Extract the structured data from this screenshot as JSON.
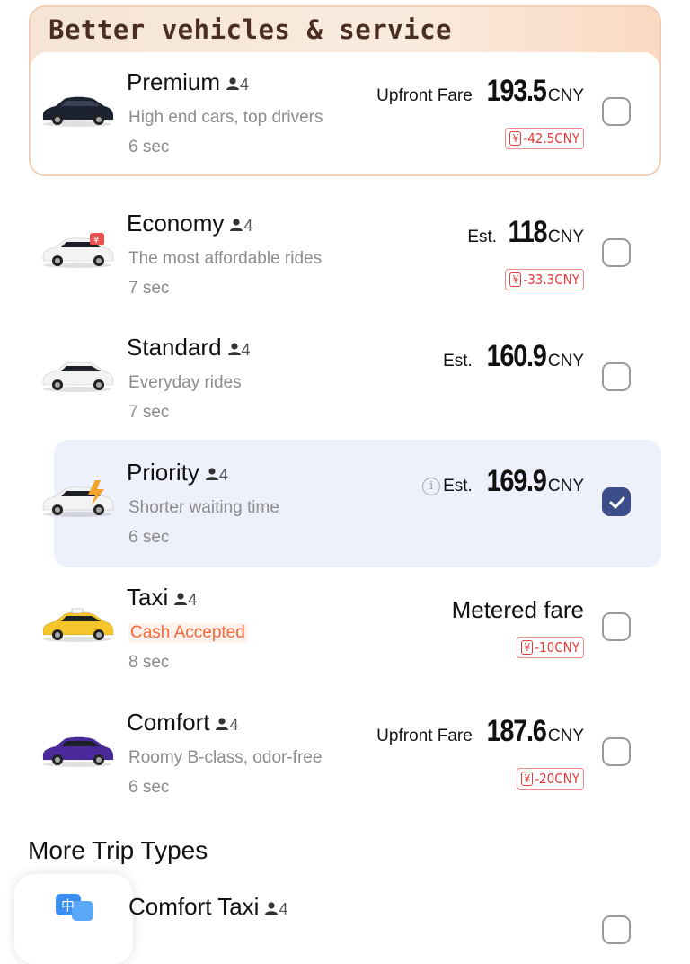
{
  "featured": {
    "title": "Better vehicles & service"
  },
  "rides": [
    {
      "name": "Premium",
      "seats": "4",
      "desc": "High end cars, top drivers",
      "eta": "6 sec",
      "price_prefix": "Upfront Fare",
      "amount": "193.5",
      "currency": "CNY",
      "discount": "-42.5CNY",
      "selected": false,
      "car_color": "#1d2230"
    },
    {
      "name": "Economy",
      "seats": "4",
      "desc": "The most affordable rides",
      "eta": "7 sec",
      "price_prefix": "Est.",
      "amount": "118",
      "currency": "CNY",
      "discount": "-33.3CNY",
      "selected": false,
      "car_color": "#f3f3f3"
    },
    {
      "name": "Standard",
      "seats": "4",
      "desc": "Everyday rides",
      "eta": "7 sec",
      "price_prefix": "Est.",
      "amount": "160.9",
      "currency": "CNY",
      "discount": "",
      "selected": false,
      "car_color": "#f3f3f3"
    },
    {
      "name": "Priority",
      "seats": "4",
      "desc": "Shorter waiting time",
      "eta": "6 sec",
      "price_prefix": "Est.",
      "amount": "169.9",
      "currency": "CNY",
      "discount": "",
      "selected": true,
      "car_color": "#f3f3f3"
    },
    {
      "name": "Taxi",
      "seats": "4",
      "desc": "Cash Accepted",
      "eta": "8 sec",
      "price_text": "Metered fare",
      "discount": "-10CNY",
      "selected": false,
      "car_color": "#f5c52c"
    },
    {
      "name": "Comfort",
      "seats": "4",
      "desc": "Roomy B-class, odor-free",
      "eta": "6 sec",
      "price_prefix": "Upfront Fare",
      "amount": "187.6",
      "currency": "CNY",
      "discount": "-20CNY",
      "selected": false,
      "car_color": "#4a2a9a"
    }
  ],
  "discount_badge_symbol": "¥",
  "more": {
    "title": "More Trip Types",
    "item_name": "Comfort Taxi",
    "item_seats": "4",
    "item_icon_text": "中"
  },
  "colors": {
    "accent": "#3d4d8a",
    "discount": "#e23b3b",
    "cash": "#f26a3d"
  }
}
